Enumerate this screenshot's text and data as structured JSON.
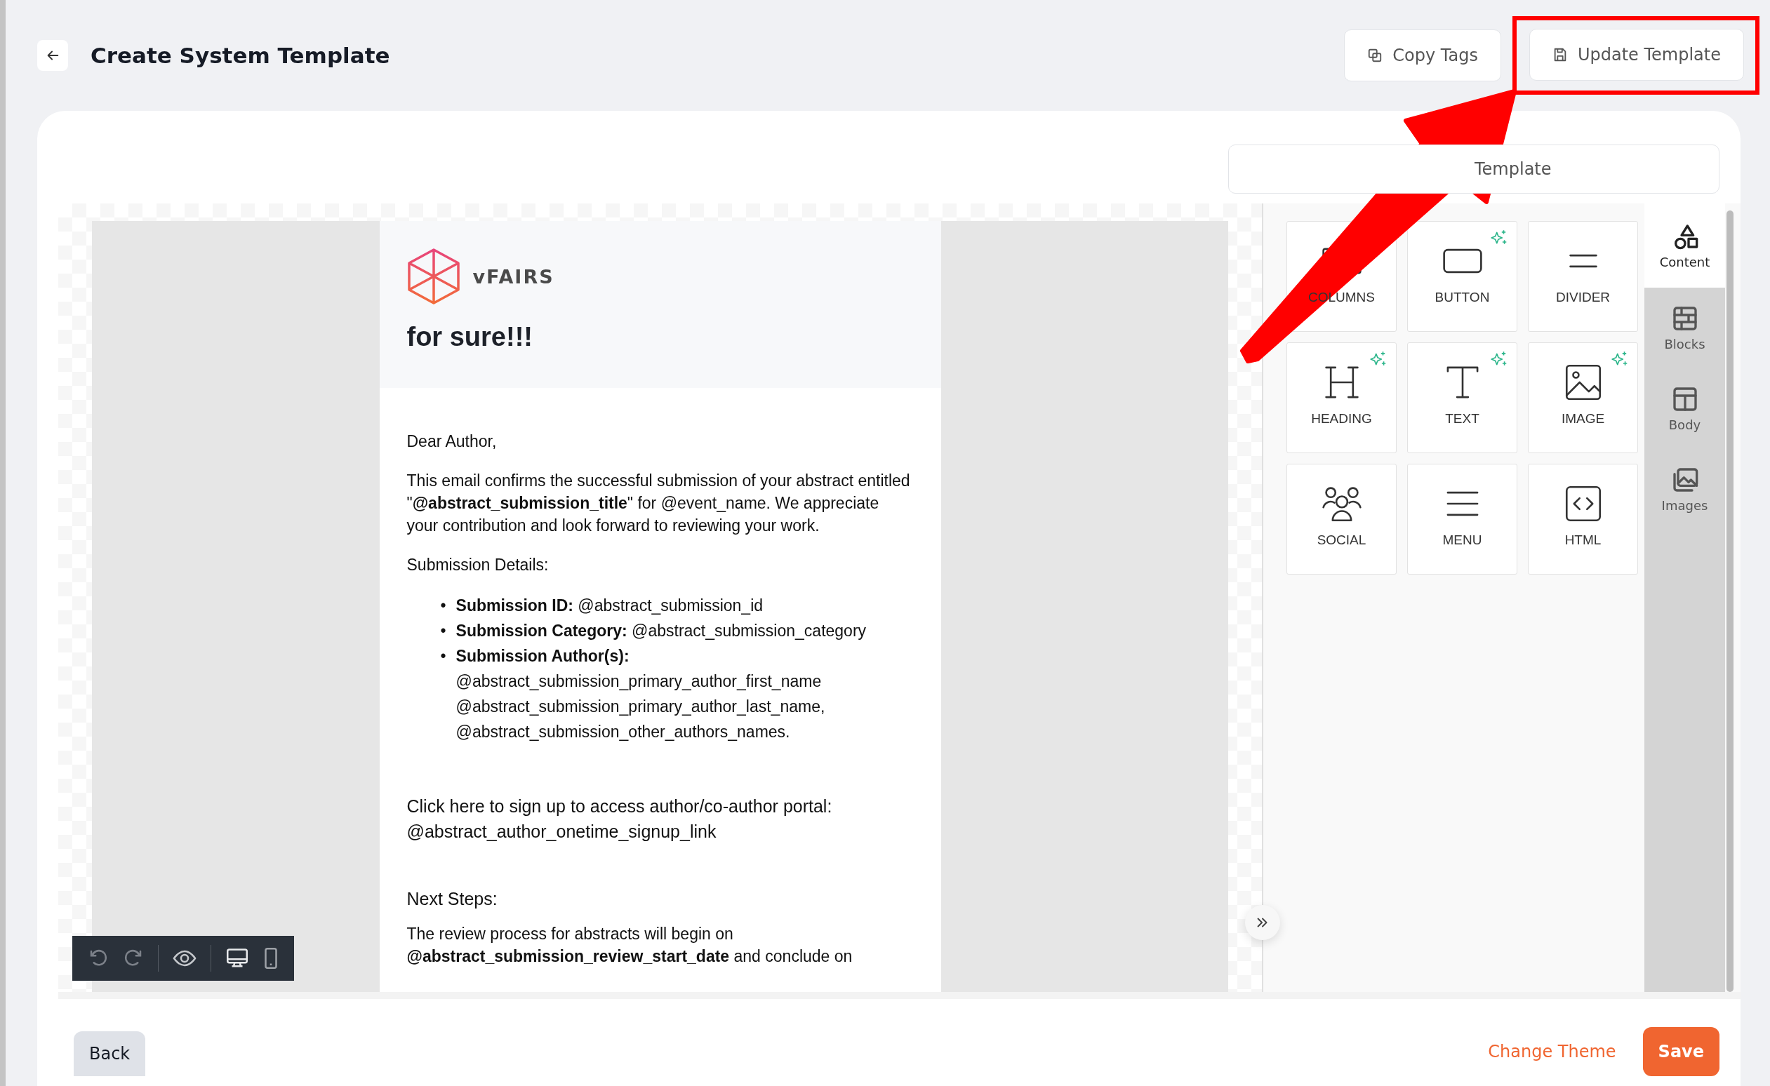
{
  "header": {
    "title": "Create System Template",
    "buttons": [
      {
        "label": "Copy Tags",
        "kind": "copy",
        "highlighted": false
      },
      {
        "label": "Update Template",
        "kind": "save",
        "highlighted": true
      }
    ]
  },
  "template_button": {
    "label": "Template"
  },
  "email": {
    "brand": "vFAIRS",
    "heading": "for sure!!!",
    "greeting": "Dear Author,",
    "intro": "This email confirms the successful submission of your abstract entitled \"**@abstract_submission_title**\" for @event_name. We appreciate your contribution and look forward to reviewing your work.",
    "details_label": "Submission Details:",
    "details": [
      {
        "bullet": "•",
        "text": "**Submission ID:** @abstract_submission_id"
      },
      {
        "bullet": "•",
        "text": "**Submission Category:** @abstract_submission_category"
      },
      {
        "bullet": "•",
        "text": "**Submission Author(s):** @abstract_submission_primary_author_first_name @abstract_submission_primary_author_last_name, @abstract_submission_other_authors_names."
      }
    ],
    "signup": "Click here to sign up to access author/co-author portal: @abstract_author_onetime_signup_link",
    "next_steps_label": "Next Steps:",
    "next_steps": "The review process for abstracts will begin on **@abstract_submission_review_start_date** and conclude on"
  },
  "content_tiles": [
    {
      "label": "COLUMNS",
      "kind": "columns",
      "ai": false
    },
    {
      "label": "BUTTON",
      "kind": "button",
      "ai": true
    },
    {
      "label": "DIVIDER",
      "kind": "divider",
      "ai": false
    },
    {
      "label": "HEADING",
      "kind": "heading",
      "ai": true
    },
    {
      "label": "TEXT",
      "kind": "text",
      "ai": true
    },
    {
      "label": "IMAGE",
      "kind": "image",
      "ai": true
    },
    {
      "label": "SOCIAL",
      "kind": "social",
      "ai": false
    },
    {
      "label": "MENU",
      "kind": "menu",
      "ai": false
    },
    {
      "label": "HTML",
      "kind": "html",
      "ai": false
    }
  ],
  "sidebar_tabs": [
    {
      "label": "Content",
      "kind": "content",
      "selected": true
    },
    {
      "label": "Blocks",
      "kind": "blocks",
      "selected": false
    },
    {
      "label": "Body",
      "kind": "body",
      "selected": false
    },
    {
      "label": "Images",
      "kind": "images",
      "selected": false
    }
  ],
  "footer": {
    "back": "Back",
    "change_theme": "Change Theme",
    "save": "Save"
  }
}
